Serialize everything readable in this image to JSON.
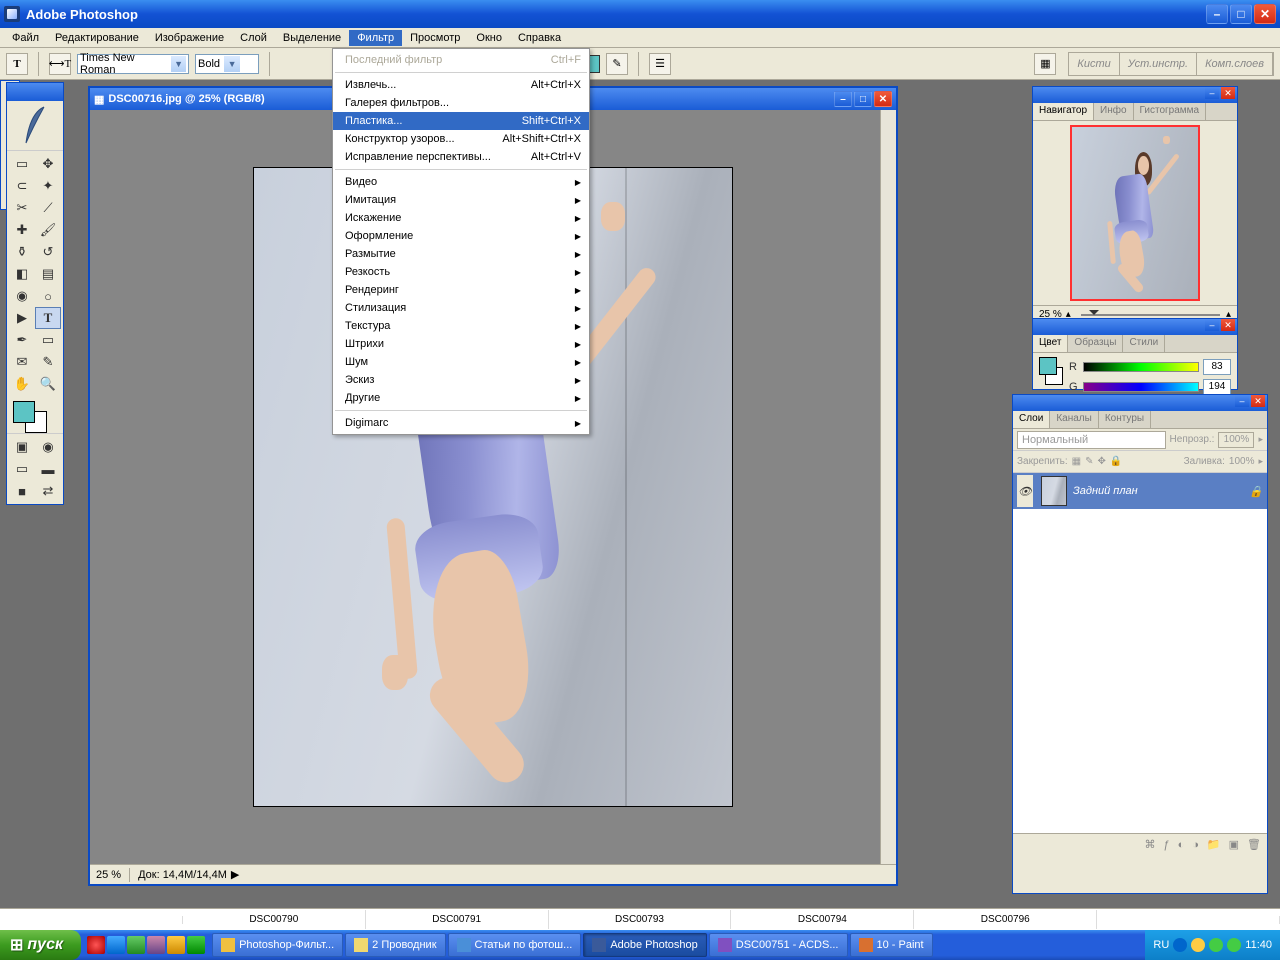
{
  "app": {
    "title": "Adobe Photoshop"
  },
  "menu": {
    "items": [
      "Файл",
      "Редактирование",
      "Изображение",
      "Слой",
      "Выделение",
      "Фильтр",
      "Просмотр",
      "Окно",
      "Справка"
    ],
    "active_index": 5
  },
  "options": {
    "font_family": "Times New Roman",
    "font_weight": "Bold"
  },
  "brush_tabs": [
    "Кисти",
    "Уст.инстр.",
    "Комп.слоев"
  ],
  "document": {
    "title": "DSC00716.jpg @ 25% (RGB/8)",
    "zoom": "25 %",
    "doc_info": "Док: 14,4M/14,4M"
  },
  "filter_menu": {
    "last_filter": {
      "label": "Последний фильтр",
      "shortcut": "Ctrl+F",
      "disabled": true
    },
    "group1": [
      {
        "label": "Извлечь...",
        "shortcut": "Alt+Ctrl+X"
      },
      {
        "label": "Галерея фильтров..."
      },
      {
        "label": "Пластика...",
        "shortcut": "Shift+Ctrl+X",
        "selected": true
      },
      {
        "label": "Конструктор узоров...",
        "shortcut": "Alt+Shift+Ctrl+X"
      },
      {
        "label": "Исправление перспективы...",
        "shortcut": "Alt+Ctrl+V"
      }
    ],
    "group2": [
      "Видео",
      "Имитация",
      "Искажение",
      "Оформление",
      "Размытие",
      "Резкость",
      "Рендеринг",
      "Стилизация",
      "Текстура",
      "Штрихи",
      "Шум",
      "Эскиз",
      "Другие"
    ],
    "group3": [
      "Digimarc"
    ]
  },
  "navigator": {
    "tabs": [
      "Навигатор",
      "Инфо",
      "Гистограмма"
    ],
    "zoom": "25 %"
  },
  "color": {
    "tabs": [
      "Цвет",
      "Образцы",
      "Стили"
    ],
    "r_label": "R",
    "r_value": "83",
    "g_label": "G",
    "g_value": "194"
  },
  "layers": {
    "tabs": [
      "Слои",
      "Каналы",
      "Контуры"
    ],
    "mode": "Нормальный",
    "opacity_label": "Непрозр.:",
    "opacity": "100%",
    "lock_label": "Закрепить:",
    "fill_label": "Заливка:",
    "fill": "100%",
    "layer_name": "Задний план"
  },
  "thumbnails": [
    "DSC00790",
    "DSC00791",
    "DSC00793",
    "DSC00794",
    "DSC00796"
  ],
  "taskbar": {
    "start": "пуск",
    "buttons": [
      {
        "label": "Photoshop-Фильт...",
        "color": "#f0c040"
      },
      {
        "label": "2 Проводник",
        "color": "#f0d870"
      },
      {
        "label": "Статьи по фотош...",
        "color": "#4a8fd8"
      },
      {
        "label": "Adobe Photoshop",
        "color": "#3a5a9a",
        "active": true
      },
      {
        "label": "DSC00751 - ACDS...",
        "color": "#8050c0"
      },
      {
        "label": "10 - Paint",
        "color": "#d87030"
      }
    ],
    "lang": "RU",
    "time": "11:40"
  },
  "colors": {
    "fg": "#5cc4c4",
    "bg": "#ffffff"
  }
}
